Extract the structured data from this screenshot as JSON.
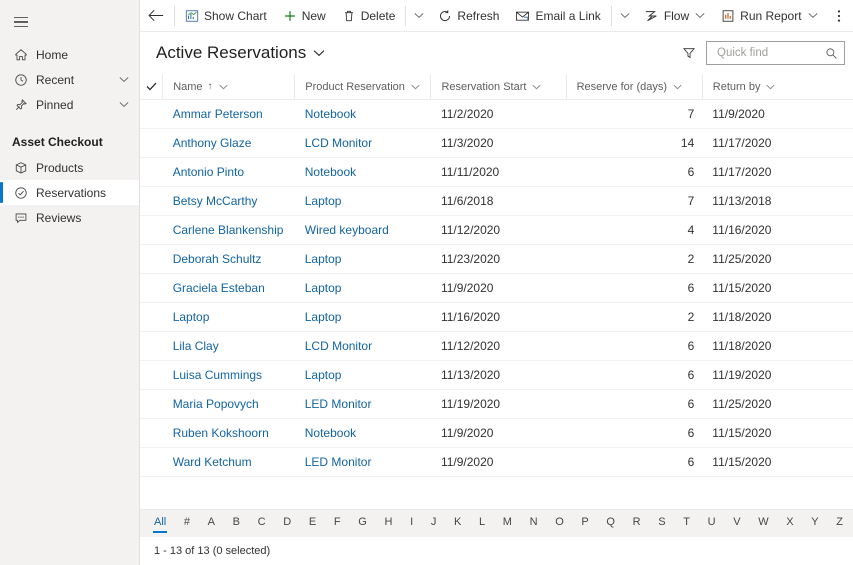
{
  "sidebar": {
    "hamburger_icon": "hamburger-icon",
    "top_items": [
      {
        "label": "Home",
        "icon": "home-icon",
        "chevron": false
      },
      {
        "label": "Recent",
        "icon": "clock-icon",
        "chevron": true
      },
      {
        "label": "Pinned",
        "icon": "pin-icon",
        "chevron": true
      }
    ],
    "section_title": "Asset Checkout",
    "group_items": [
      {
        "label": "Products",
        "icon": "box-icon",
        "selected": false
      },
      {
        "label": "Reservations",
        "icon": "check-circle-icon",
        "selected": true
      },
      {
        "label": "Reviews",
        "icon": "comment-icon",
        "selected": false
      }
    ]
  },
  "commandbar": {
    "back_icon": "back-arrow-icon",
    "buttons": [
      {
        "label": "Show Chart",
        "icon": "chart-icon",
        "chevron": false
      },
      {
        "label": "New",
        "icon": "plus-icon",
        "chevron": false
      },
      {
        "label": "Delete",
        "icon": "trash-icon",
        "chevron": false,
        "split": true
      },
      {
        "label": "Refresh",
        "icon": "refresh-icon",
        "chevron": false
      },
      {
        "label": "Email a Link",
        "icon": "email-link-icon",
        "chevron": false,
        "split": true
      },
      {
        "label": "Flow",
        "icon": "flow-icon",
        "chevron": true
      },
      {
        "label": "Run Report",
        "icon": "report-icon",
        "chevron": true
      }
    ],
    "overflow_icon": "more-vertical-icon"
  },
  "view": {
    "title": "Active Reservations",
    "title_chevron_icon": "chevron-down-icon",
    "filter_icon": "filter-icon",
    "search": {
      "placeholder": "Quick find",
      "value": "",
      "icon": "search-icon"
    }
  },
  "grid": {
    "select_all_icon": "checkmark-icon",
    "columns": [
      {
        "label": "Name",
        "sort": "ascending",
        "sort_glyph": "↑",
        "chevron_icon": "chevron-down-icon"
      },
      {
        "label": "Product Reservation",
        "chevron_icon": "chevron-down-icon"
      },
      {
        "label": "Reservation Start",
        "chevron_icon": "chevron-down-icon"
      },
      {
        "label": "Reserve for (days)",
        "chevron_icon": "chevron-down-icon"
      },
      {
        "label": "Return by",
        "chevron_icon": "chevron-down-icon"
      }
    ],
    "rows": [
      {
        "name": "Ammar Peterson",
        "product": "Notebook",
        "start": "11/2/2020",
        "days": "7",
        "return": "11/9/2020"
      },
      {
        "name": "Anthony Glaze",
        "product": "LCD Monitor",
        "start": "11/3/2020",
        "days": "14",
        "return": "11/17/2020"
      },
      {
        "name": "Antonio Pinto",
        "product": "Notebook",
        "start": "11/11/2020",
        "days": "6",
        "return": "11/17/2020"
      },
      {
        "name": "Betsy McCarthy",
        "product": "Laptop",
        "start": "11/6/2018",
        "days": "7",
        "return": "11/13/2018"
      },
      {
        "name": "Carlene Blankenship",
        "product": "Wired keyboard",
        "start": "11/12/2020",
        "days": "4",
        "return": "11/16/2020"
      },
      {
        "name": "Deborah Schultz",
        "product": "Laptop",
        "start": "11/23/2020",
        "days": "2",
        "return": "11/25/2020"
      },
      {
        "name": "Graciela Esteban",
        "product": "Laptop",
        "start": "11/9/2020",
        "days": "6",
        "return": "11/15/2020"
      },
      {
        "name": "Laptop",
        "product": "Laptop",
        "start": "11/16/2020",
        "days": "2",
        "return": "11/18/2020"
      },
      {
        "name": "Lila Clay",
        "product": "LCD Monitor",
        "start": "11/12/2020",
        "days": "6",
        "return": "11/18/2020"
      },
      {
        "name": "Luisa Cummings",
        "product": "Laptop",
        "start": "11/13/2020",
        "days": "6",
        "return": "11/19/2020"
      },
      {
        "name": "Maria Popovych",
        "product": "LED Monitor",
        "start": "11/19/2020",
        "days": "6",
        "return": "11/25/2020"
      },
      {
        "name": "Ruben Kokshoorn",
        "product": "Notebook",
        "start": "11/9/2020",
        "days": "6",
        "return": "11/15/2020"
      },
      {
        "name": "Ward Ketchum",
        "product": "LED Monitor",
        "start": "11/9/2020",
        "days": "6",
        "return": "11/15/2020"
      }
    ]
  },
  "alphabar": {
    "selected": "All",
    "items": [
      "All",
      "#",
      "A",
      "B",
      "C",
      "D",
      "E",
      "F",
      "G",
      "H",
      "I",
      "J",
      "K",
      "L",
      "M",
      "N",
      "O",
      "P",
      "Q",
      "R",
      "S",
      "T",
      "U",
      "V",
      "W",
      "X",
      "Y",
      "Z"
    ]
  },
  "status": {
    "text": "1 - 13 of 13 (0 selected)"
  },
  "colors": {
    "accent": "#0078d4",
    "link": "#1264a3",
    "sidebar_bg": "#f3f2f1",
    "new_green": "#107c10"
  }
}
